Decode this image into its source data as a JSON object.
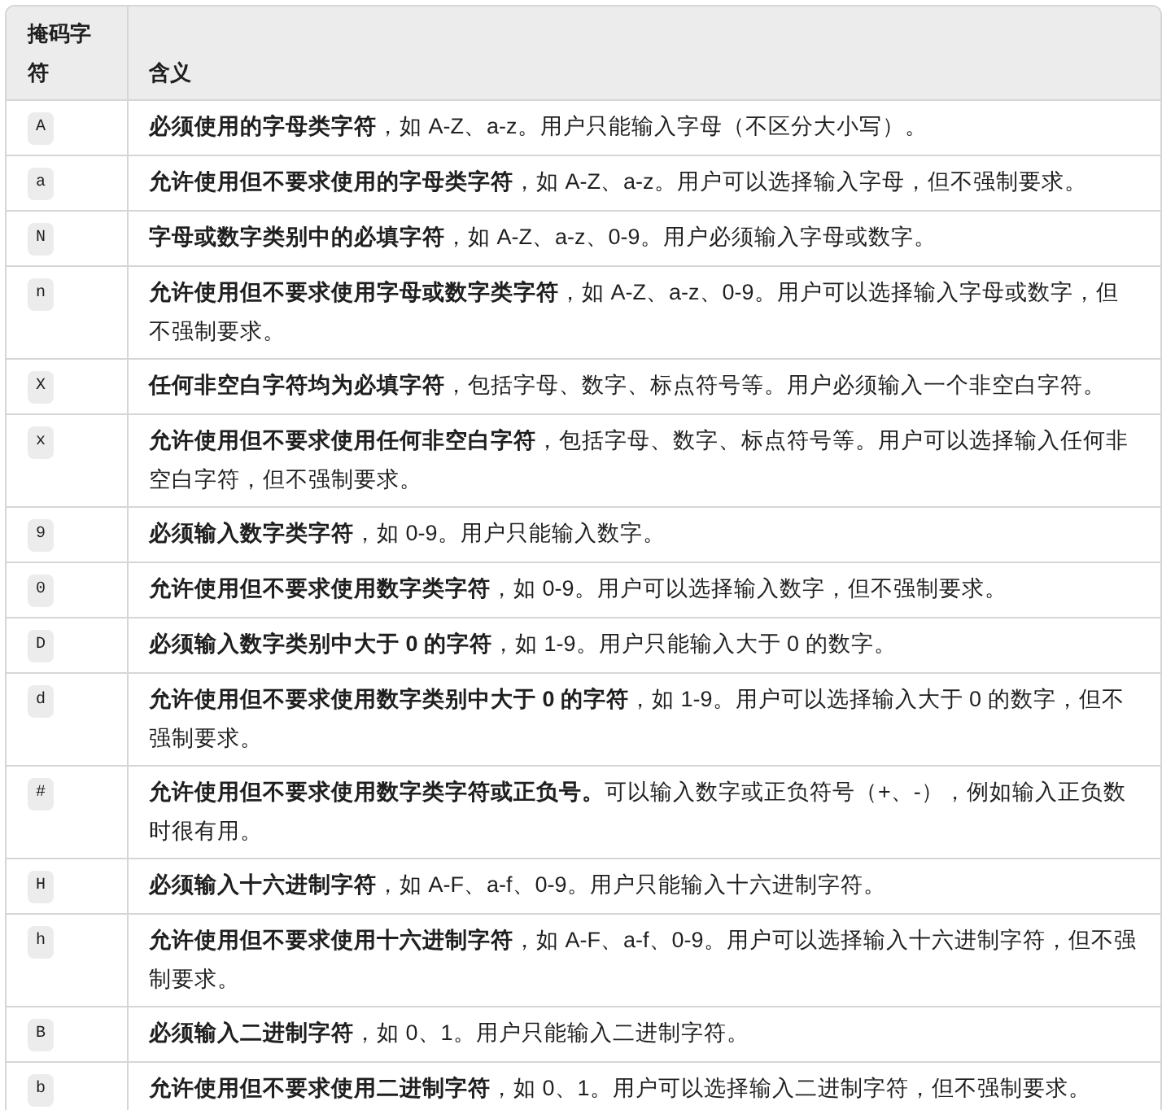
{
  "table": {
    "columns": [
      "掩码字符",
      "含义"
    ],
    "rows": [
      {
        "code": "A",
        "meaning": "**必须使用的字母类字符**，如 A-Z、a-z。用户只能输入字母（不区分大小写）。"
      },
      {
        "code": "a",
        "meaning": "**允许使用但不要求使用的字母类字符**，如 A-Z、a-z。用户可以选择输入字母，但不强制要求。"
      },
      {
        "code": "N",
        "meaning": "**字母或数字类别中的必填字符**，如 A-Z、a-z、0-9。用户必须输入字母或数字。"
      },
      {
        "code": "n",
        "meaning": "**允许使用但不要求使用字母或数字类字符**，如 A-Z、a-z、0-9。用户可以选择输入字母或数字，但不强制要求。"
      },
      {
        "code": "X",
        "meaning": "**任何非空白字符均为必填字符**，包括字母、数字、标点符号等。用户必须输入一个非空白字符。"
      },
      {
        "code": "x",
        "meaning": "**允许使用但不要求使用任何非空白字符**，包括字母、数字、标点符号等。用户可以选择输入任何非空白字符，但不强制要求。"
      },
      {
        "code": "9",
        "meaning": "**必须输入数字类字符**，如 0-9。用户只能输入数字。"
      },
      {
        "code": "0",
        "meaning": "**允许使用但不要求使用数字类字符**，如 0-9。用户可以选择输入数字，但不强制要求。"
      },
      {
        "code": "D",
        "meaning": "**必须输入数字类别中大于 0 的字符**，如 1-9。用户只能输入大于 0 的数字。"
      },
      {
        "code": "d",
        "meaning": "**允许使用但不要求使用数字类别中大于 0 的字符**，如 1-9。用户可以选择输入大于 0 的数字，但不强制要求。"
      },
      {
        "code": "#",
        "meaning": "**允许使用但不要求使用数字类字符或正负号。**可以输入数字或正负符号（+、-），例如输入正负数时很有用。"
      },
      {
        "code": "H",
        "meaning": "**必须输入十六进制字符**，如 A-F、a-f、0-9。用户只能输入十六进制字符。"
      },
      {
        "code": "h",
        "meaning": "**允许使用但不要求使用十六进制字符**，如 A-F、a-f、0-9。用户可以选择输入十六进制字符，但不强制要求。"
      },
      {
        "code": "B",
        "meaning": "**必须输入二进制字符**，如 0、1。用户只能输入二进制字符。"
      },
      {
        "code": "b",
        "meaning": "**允许使用但不要求使用二进制字符**，如 0、1。用户可以选择输入二进制字符，但不强制要求。"
      }
    ]
  }
}
